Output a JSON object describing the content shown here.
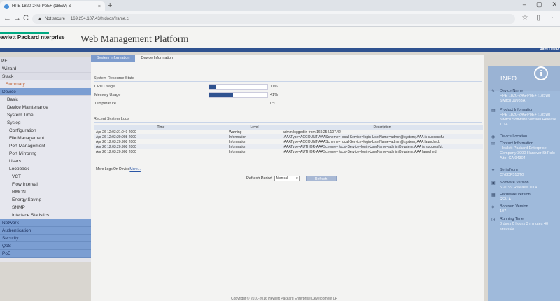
{
  "browser": {
    "tab_title": "HPE 1820-24G-PoE+ (185W) S",
    "tab_close": "×",
    "new_tab": "+",
    "nav_back": "←",
    "nav_forward": "→",
    "nav_reload": "C",
    "security_label": "Not secure",
    "url": "169.254.107.43/htdocs/frame.cl",
    "star": "☆",
    "window_min": "–",
    "window_max": "▢",
    "window_close": "✕"
  },
  "header": {
    "logo_text": "ewlett Packard nterprise",
    "title": "Web Management Platform",
    "save_help": "Save | Help"
  },
  "sidebar": {
    "items": [
      {
        "label": "PE",
        "level": "l0"
      },
      {
        "label": "Wizard",
        "level": "l1"
      },
      {
        "label": "Stack",
        "level": "l1"
      },
      {
        "label": "Summary",
        "level": "hl"
      },
      {
        "label": "Device",
        "level": "l1a"
      },
      {
        "label": "Basic",
        "level": "l2"
      },
      {
        "label": "Device Maintenance",
        "level": "l2"
      },
      {
        "label": "System Time",
        "level": "l2"
      },
      {
        "label": "Syslog",
        "level": "l2"
      },
      {
        "label": "Configuration",
        "level": "l3"
      },
      {
        "label": "File Management",
        "level": "l3"
      },
      {
        "label": "Port Management",
        "level": "l3"
      },
      {
        "label": "Port Mirroring",
        "level": "l3"
      },
      {
        "label": "Users",
        "level": "l3"
      },
      {
        "label": "Loopback",
        "level": "l3"
      },
      {
        "label": "VCT",
        "level": "l4"
      },
      {
        "label": "Flow Interval",
        "level": "l4"
      },
      {
        "label": "RMON",
        "level": "l4"
      },
      {
        "label": "Energy Saving",
        "level": "l4"
      },
      {
        "label": "SNMP",
        "level": "l4"
      },
      {
        "label": "Interface Statistics",
        "level": "l4"
      },
      {
        "label": "Network",
        "level": "l1c"
      },
      {
        "label": "Authentication",
        "level": "l1c"
      },
      {
        "label": "Security",
        "level": "l1c"
      },
      {
        "label": "QoS",
        "level": "l1c"
      },
      {
        "label": "PoE",
        "level": "l1c"
      }
    ]
  },
  "main": {
    "tabs": [
      "System Information",
      "Device Information"
    ],
    "resource_title": "System Resource State",
    "resources": [
      {
        "label": "CPU Usage",
        "fill": 0.11,
        "value": "11%"
      },
      {
        "label": "Memory Usage",
        "fill": 0.41,
        "value": "41%"
      },
      {
        "label": "Temperature",
        "fill": 0,
        "value": "0°C"
      }
    ],
    "logs_title": "Recent System Logs",
    "log_headers": [
      "Time",
      "Level",
      "Description"
    ],
    "logs": [
      [
        "Apr 26 12:03:21:049 2000",
        "Warning",
        "admin logged in from 169.254.107.42"
      ],
      [
        "Apr 26 12:03:20:908 2000",
        "Information",
        "-AAAType=ACCOUNT-AAAScheme= local-Service=login-UserName=admin@system; AAA is successful"
      ],
      [
        "Apr 26 12:03:20:908 2000",
        "Information",
        "-AAAType=ACCOUNT-AAAScheme= local-Service=login-UserName=admin@system; AAA launched."
      ],
      [
        "Apr 26 12:03:20:908 2000",
        "Information",
        "-AAAType=AUTHOR-AAAScheme= local-Service=login-UserName=admin@system; AAA is successful."
      ],
      [
        "Apr 26 12:03:20:908 2000",
        "Information",
        "-AAAType=AUTHOR-AAAScheme= local-Service=login-UserName=admin@system; AAA launched."
      ]
    ],
    "more_logs_prefix": "More Logs On Device",
    "more_logs_link": "More...",
    "refresh_label": "Refresh Period",
    "refresh_value": "Manual",
    "refresh_button": "Refresh",
    "footer": "Copyright © 2010-2016 Hewlett Packard Enterprise Development LP"
  },
  "info": {
    "title": "INFO",
    "entries": [
      {
        "icon": "✎",
        "label": "Device Name",
        "value": "HPE 1820-24G-PoE+ (185W) Switch J9983A"
      },
      {
        "icon": "▤",
        "label": "Product Information",
        "value": "HPE 1820-24G-PoE+ (185W) Switch Software Version Release 1114"
      },
      {
        "icon": "◉",
        "label": "Device Location",
        "value": ""
      },
      {
        "icon": "✉",
        "label": "Contact Information",
        "value": "Hewlett Packard Enterprise Company 3000 Hanover St Palo Alto, CA 94304"
      },
      {
        "icon": "✦",
        "label": "SerialNum",
        "value": "CN8DF513TG"
      },
      {
        "icon": "▣",
        "label": "Software Version",
        "value": "5.20.99 Release 1114"
      },
      {
        "icon": "▦",
        "label": "Hardware Version",
        "value": "REV.A"
      },
      {
        "icon": "◈",
        "label": "Bootrom Version",
        "value": "107"
      },
      {
        "icon": "◷",
        "label": "Running Time",
        "value": "0 days 0 hours 3 minutes 40 seconds"
      }
    ]
  }
}
